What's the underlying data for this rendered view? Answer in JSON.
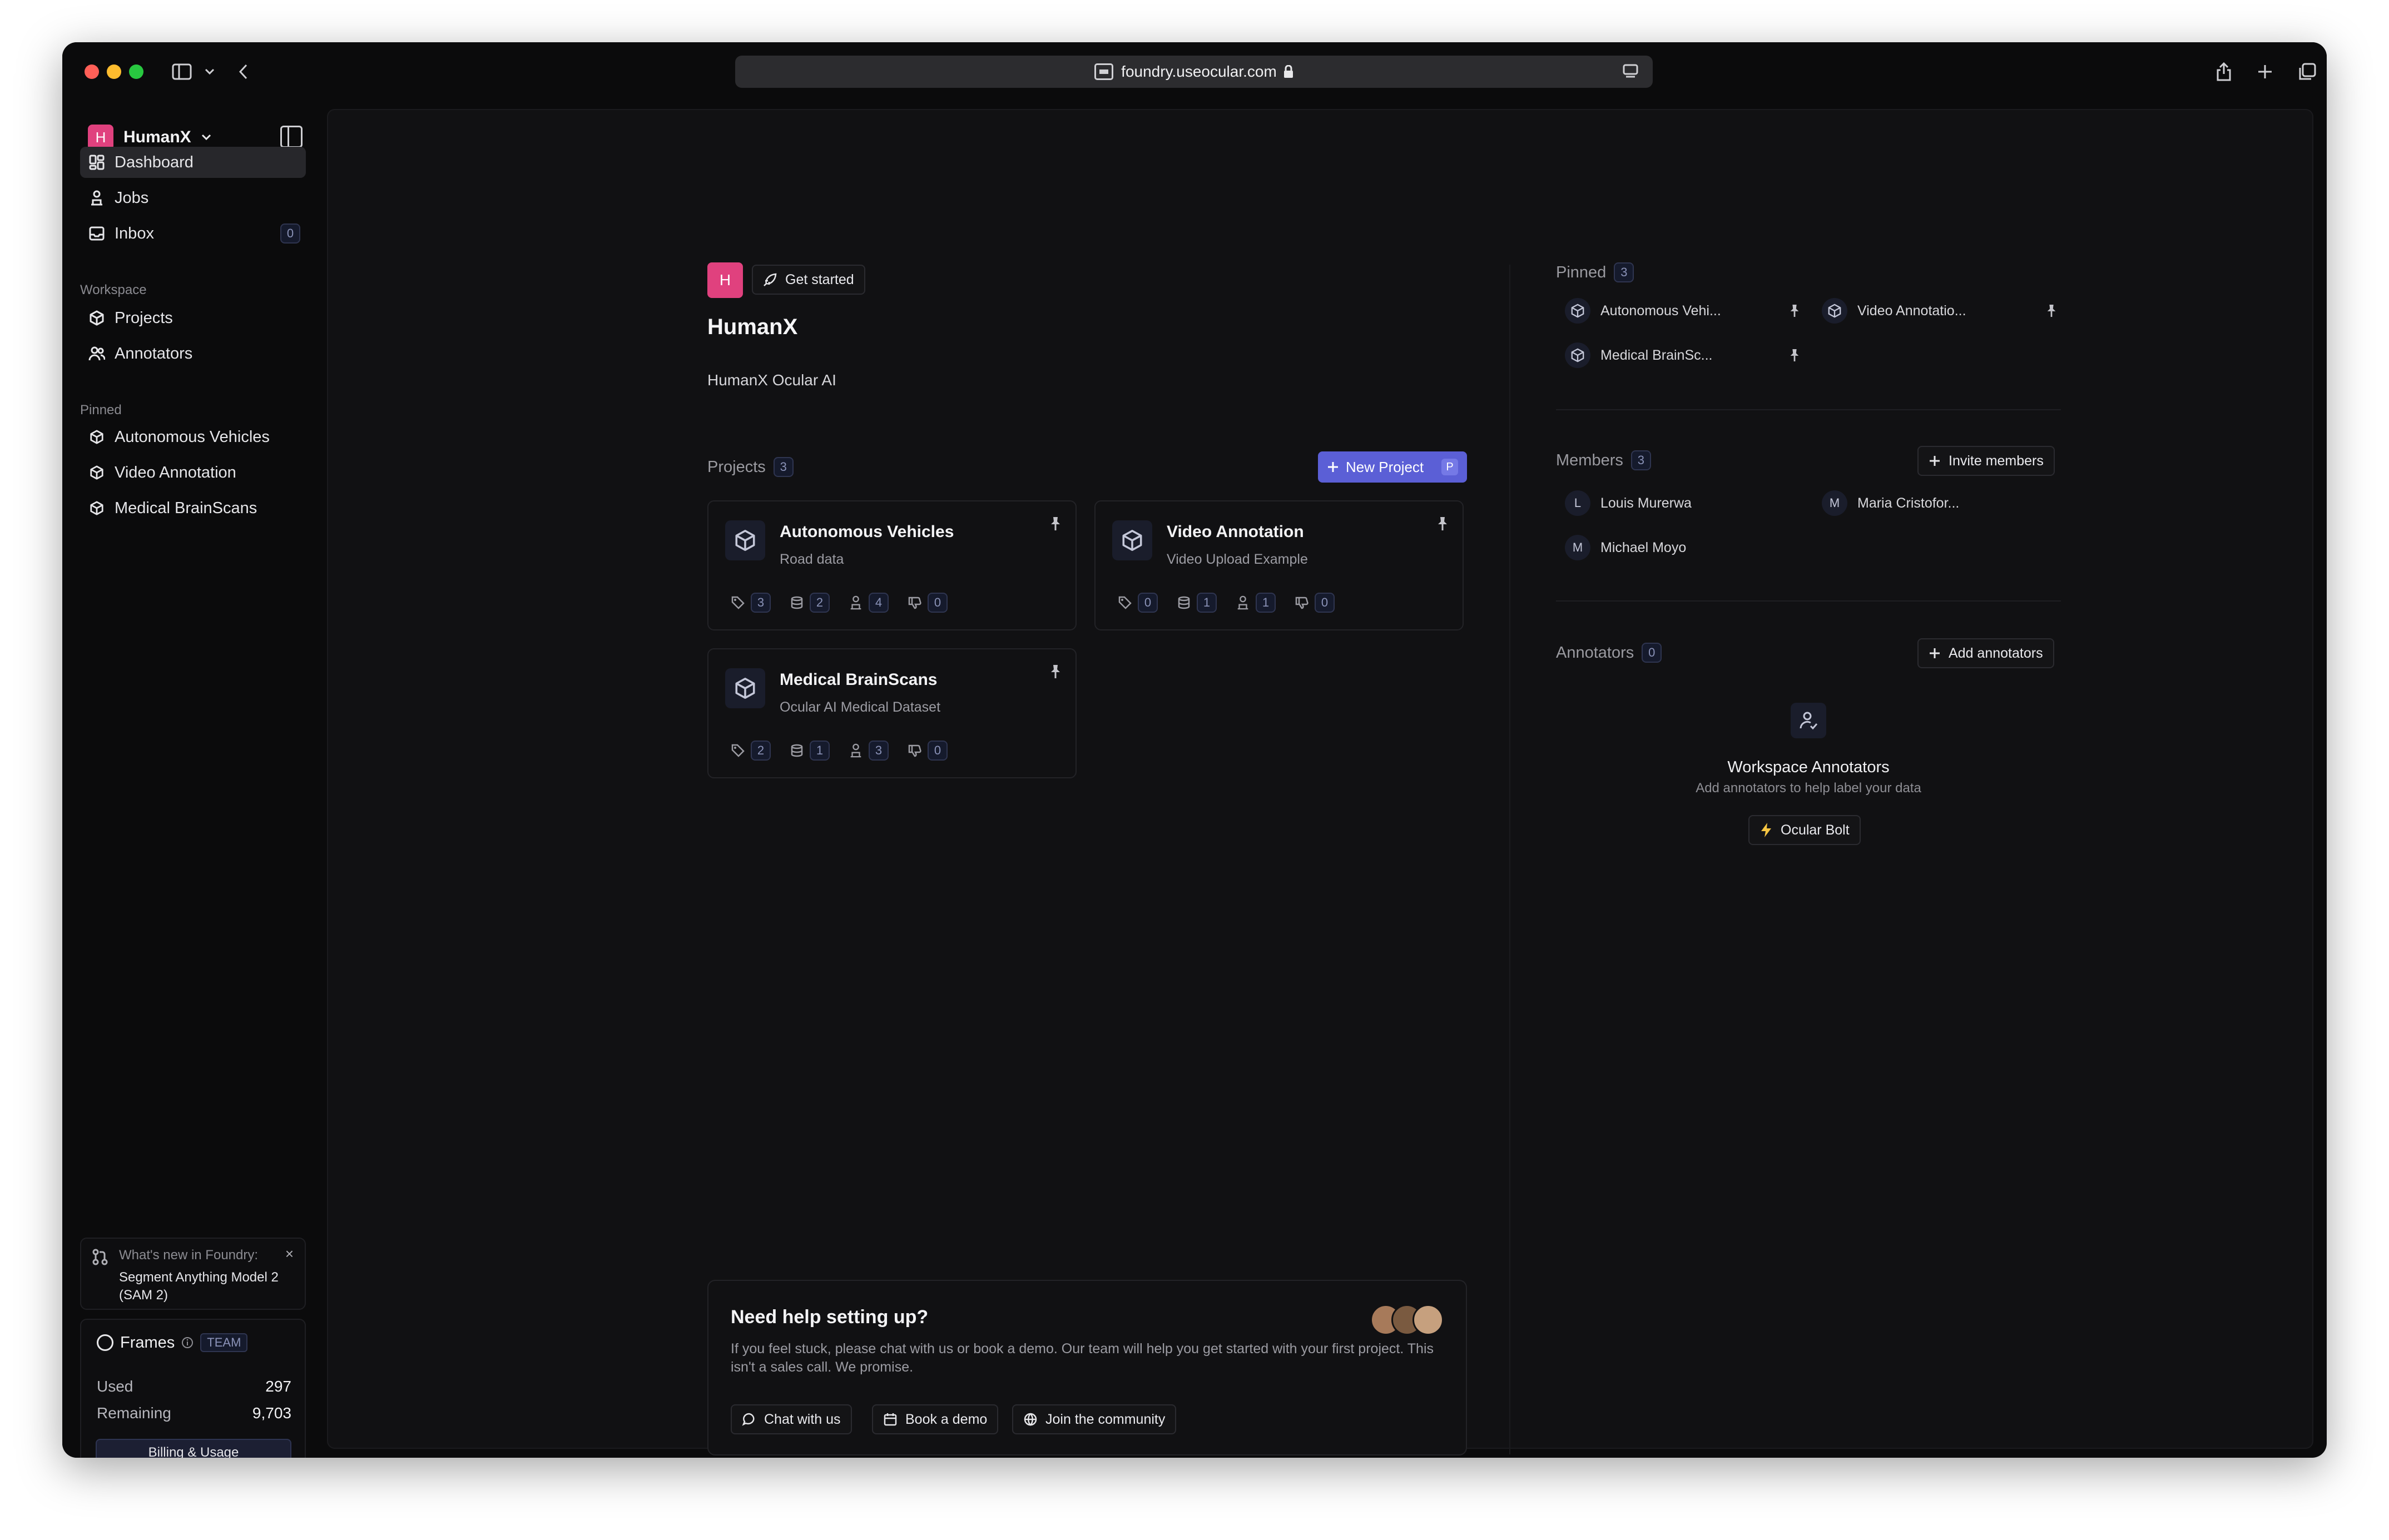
{
  "browser": {
    "url": "foundry.useocular.com"
  },
  "workspace": {
    "initial": "H",
    "name": "HumanX"
  },
  "sidebar": {
    "nav": [
      {
        "label": "Dashboard",
        "icon": "dashboard-icon",
        "active": true
      },
      {
        "label": "Jobs",
        "icon": "jobs-icon"
      },
      {
        "label": "Inbox",
        "icon": "inbox-icon",
        "count": "0"
      }
    ],
    "workspace_label": "Workspace",
    "workspace_items": [
      {
        "label": "Projects",
        "icon": "cube-icon"
      },
      {
        "label": "Annotators",
        "icon": "users-icon"
      }
    ],
    "pinned_label": "Pinned",
    "pinned_items": [
      "Autonomous Vehicles",
      "Video Annotation",
      "Medical BrainScans"
    ],
    "whats_new": {
      "title": "What's new in Foundry:",
      "body": "Segment Anything Model 2 (SAM 2)"
    },
    "frames": {
      "title": "Frames",
      "tag": "TEAM",
      "used_label": "Used",
      "used": "297",
      "remaining_label": "Remaining",
      "remaining": "9,703",
      "billing_button": "Billing & Usage"
    }
  },
  "main": {
    "avatar_initial": "H",
    "get_started": "Get started",
    "title": "HumanX",
    "subtitle": "HumanX Ocular AI",
    "projects_label": "Projects",
    "projects_count": "3",
    "new_project": "New Project",
    "new_project_shortcut": "P",
    "projects": [
      {
        "name": "Autonomous Vehicles",
        "desc": "Road data",
        "tags": "3",
        "datasets": "2",
        "jobs": "4",
        "reviews": "0"
      },
      {
        "name": "Video Annotation",
        "desc": "Video Upload Example",
        "tags": "0",
        "datasets": "1",
        "jobs": "1",
        "reviews": "0"
      },
      {
        "name": "Medical BrainScans",
        "desc": "Ocular AI Medical Dataset",
        "tags": "2",
        "datasets": "1",
        "jobs": "3",
        "reviews": "0"
      }
    ],
    "help": {
      "title": "Need help setting up?",
      "body": "If you feel stuck, please chat with us or book a demo. Our team will help you get started with your first project. This isn't a sales call. We promise.",
      "chat": "Chat with us",
      "demo": "Book a demo",
      "community": "Join the community"
    }
  },
  "right": {
    "pinned_label": "Pinned",
    "pinned_count": "3",
    "pinned": [
      "Autonomous Vehi...",
      "Video Annotatio...",
      "Medical BrainSc..."
    ],
    "members_label": "Members",
    "members_count": "3",
    "invite": "Invite members",
    "members": [
      {
        "initial": "L",
        "name": "Louis Murerwa"
      },
      {
        "initial": "M",
        "name": "Maria Cristofor..."
      },
      {
        "initial": "M",
        "name": "Michael Moyo"
      }
    ],
    "annotators_label": "Annotators",
    "annotators_count": "0",
    "add_annotators": "Add annotators",
    "empty_title": "Workspace Annotators",
    "empty_sub": "Add annotators to help label your data",
    "bolt": "Ocular Bolt"
  },
  "colors": {
    "accent": "#5b5fd6",
    "workspace_avatar": "#e0417e",
    "background": "#0b0b0c"
  }
}
